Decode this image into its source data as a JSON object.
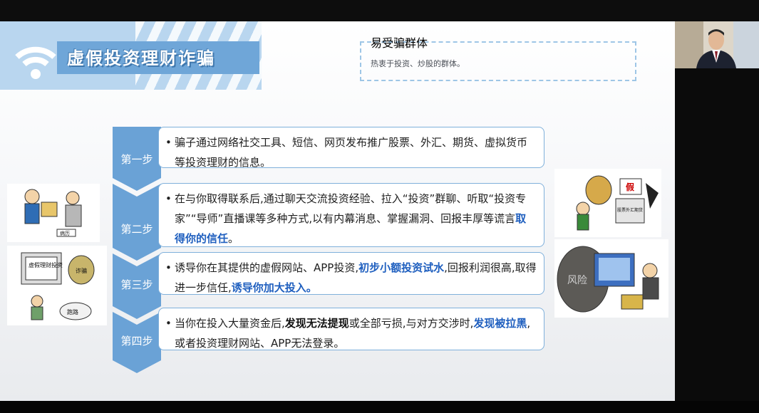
{
  "slide": {
    "title": "虚假投资理财诈骗",
    "victims": {
      "heading": "易受骗群体",
      "desc": "热衷于投资、炒股的群体。"
    },
    "steps": [
      {
        "label": "第一步",
        "parts": [
          {
            "t": "骗子通过网络社交工具、短信、网页发布推广股票、外汇、期货、虚拟货币等投资理财的信息。",
            "s": "n"
          }
        ]
      },
      {
        "label": "第二步",
        "parts": [
          {
            "t": "在与你取得联系后,通过聊天交流投资经验、拉入“投资”群聊、听取“投资专家”“导师”直播课等多种方式,以有内幕消息、掌握漏洞、回报丰厚等谎言",
            "s": "n"
          },
          {
            "t": "取得你的信任",
            "s": "h"
          },
          {
            "t": "。",
            "s": "n"
          }
        ]
      },
      {
        "label": "第三步",
        "parts": [
          {
            "t": "诱导你在其提供的虚假网站、APP投资,",
            "s": "n"
          },
          {
            "t": "初步小额投资试水",
            "s": "h"
          },
          {
            "t": ",回报利润很高,取得进一步信任,",
            "s": "n"
          },
          {
            "t": "诱导你加大投入。",
            "s": "h"
          }
        ]
      },
      {
        "label": "第四步",
        "parts": [
          {
            "t": "当你在投入大量资金后,",
            "s": "n"
          },
          {
            "t": "发现无法提现",
            "s": "b"
          },
          {
            "t": "或全部亏损,与对方交涉时,",
            "s": "n"
          },
          {
            "t": "发现被拉黑",
            "s": "h"
          },
          {
            "t": ",或者投资理财网站、APP无法登录。",
            "s": "n"
          }
        ]
      }
    ],
    "cartoons": {
      "left_top_caption": "病历",
      "left_bottom_monitor": "虚假理财投资",
      "left_bottom_bag": "诈骗",
      "left_bottom_bubble": "跑路",
      "right_top_sign": "假",
      "right_top_screen": "股票外汇期货",
      "right_bottom_wall": "风险"
    }
  },
  "colors": {
    "accent": "#6fa6d8",
    "highlight": "#1f5fbf",
    "border": "#7fb0db"
  }
}
